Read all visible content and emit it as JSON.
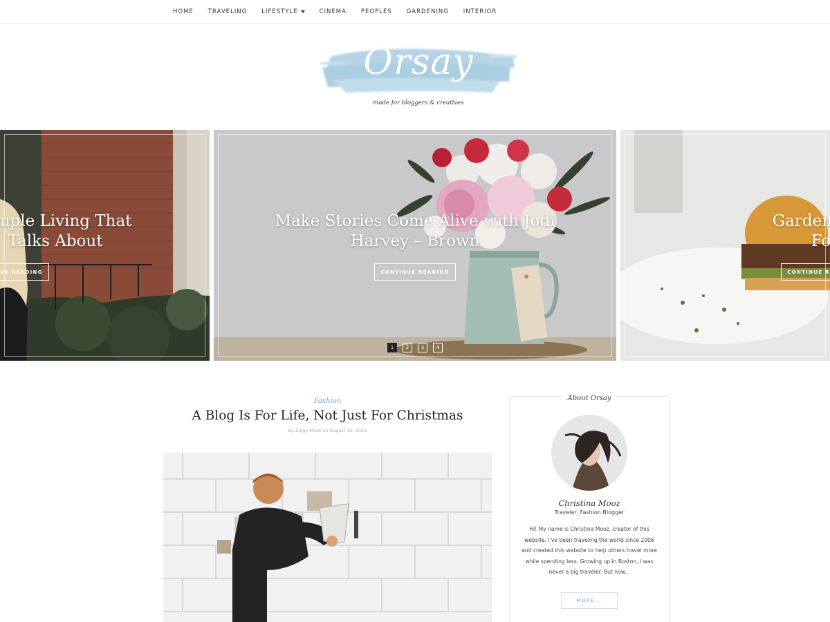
{
  "nav": {
    "items": [
      {
        "label": "HOME"
      },
      {
        "label": "TRAVELING"
      },
      {
        "label": "LIFESTYLE"
      },
      {
        "label": "CINEMA"
      },
      {
        "label": "PEOPLES"
      },
      {
        "label": "GARDENING"
      },
      {
        "label": "INTERIOR"
      }
    ]
  },
  "logo": {
    "text": "Orsay",
    "tagline": "made for bloggers & creatives"
  },
  "slider": {
    "slides": [
      {
        "title_line1": "Simple Living That",
        "title_line2": "Talks About",
        "button": "CONTINUE READING"
      },
      {
        "title_line1": "Make Stories Come Alive with Jodi",
        "title_line2": "Harvey – Brown",
        "button": "CONTINUE READING"
      },
      {
        "title_line1": "Gardening Is The",
        "title_line2": "For The",
        "button": "CONTINUE READING"
      }
    ],
    "pagination": [
      "1",
      "2",
      "3",
      "4"
    ],
    "active_page": 1
  },
  "post": {
    "category": "Fashion",
    "title": "A Blog Is For Life, Not Just For Christmas",
    "meta": "By Ziggy Mooz on August 15, 2016"
  },
  "sidebar": {
    "widget_title": "About Orsay",
    "author_name": "Christina Mooz",
    "author_role": "Traveler, Fashion Blogger",
    "bio": "Hi! My name is Christina Mooz, creator of this website. I've been traveling the world since 2006 and created this website to help others travel more while spending less. Growing up in Boston, I was never a big traveler. But now...",
    "more_button": "MORE..."
  },
  "colors": {
    "accent": "#6aa8cc",
    "logo_brush": "#a9cde2",
    "text": "#222222"
  }
}
